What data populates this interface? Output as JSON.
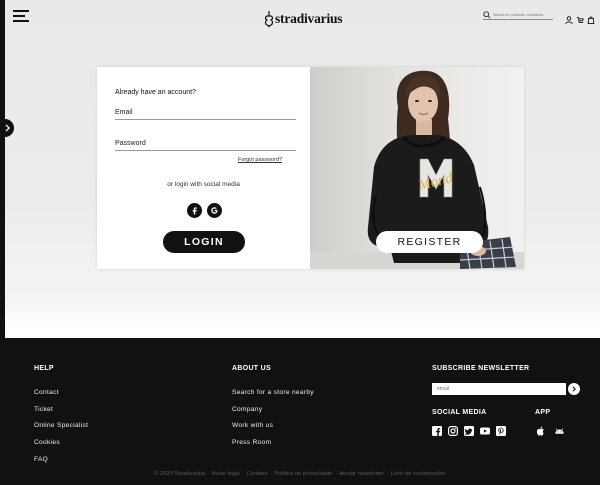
{
  "header": {
    "logo_text": "stradivarius",
    "search_placeholder": "Search for products, collections...",
    "icons": [
      "menu-icon",
      "search-icon",
      "user-icon",
      "bag-icon",
      "cart-icon"
    ]
  },
  "login": {
    "title": "Already have an account?",
    "email_label": "Email",
    "password_label": "Password",
    "forgot_label": "Forgot password?",
    "social_text": "or login with social media",
    "login_button": "LOGIN"
  },
  "register": {
    "button": "REGISTER"
  },
  "footer": {
    "help": {
      "title": "HELP",
      "links": [
        "Contact",
        "Ticket",
        "Online Specialist",
        "Cookies",
        "FAQ"
      ]
    },
    "about": {
      "title": "ABOUT US",
      "links": [
        "Search for a store nearby",
        "Company",
        "Work with us",
        "Press Room"
      ]
    },
    "newsletter": {
      "title": "SUBSCRIBE NEWSLETTER",
      "placeholder": "email"
    },
    "social_media_title": "SOCIAL MEDIA",
    "app_title": "APP",
    "bottom": {
      "copyright": "© 2020 Stradivarius",
      "links": [
        "Aviso legal",
        "Cookies",
        "Política de privacidade",
        "Anular newsletter",
        "Livro de reclamações"
      ]
    }
  },
  "colors": {
    "accent": "#111111",
    "background": "#ececec",
    "footer_bg": "#111111"
  }
}
